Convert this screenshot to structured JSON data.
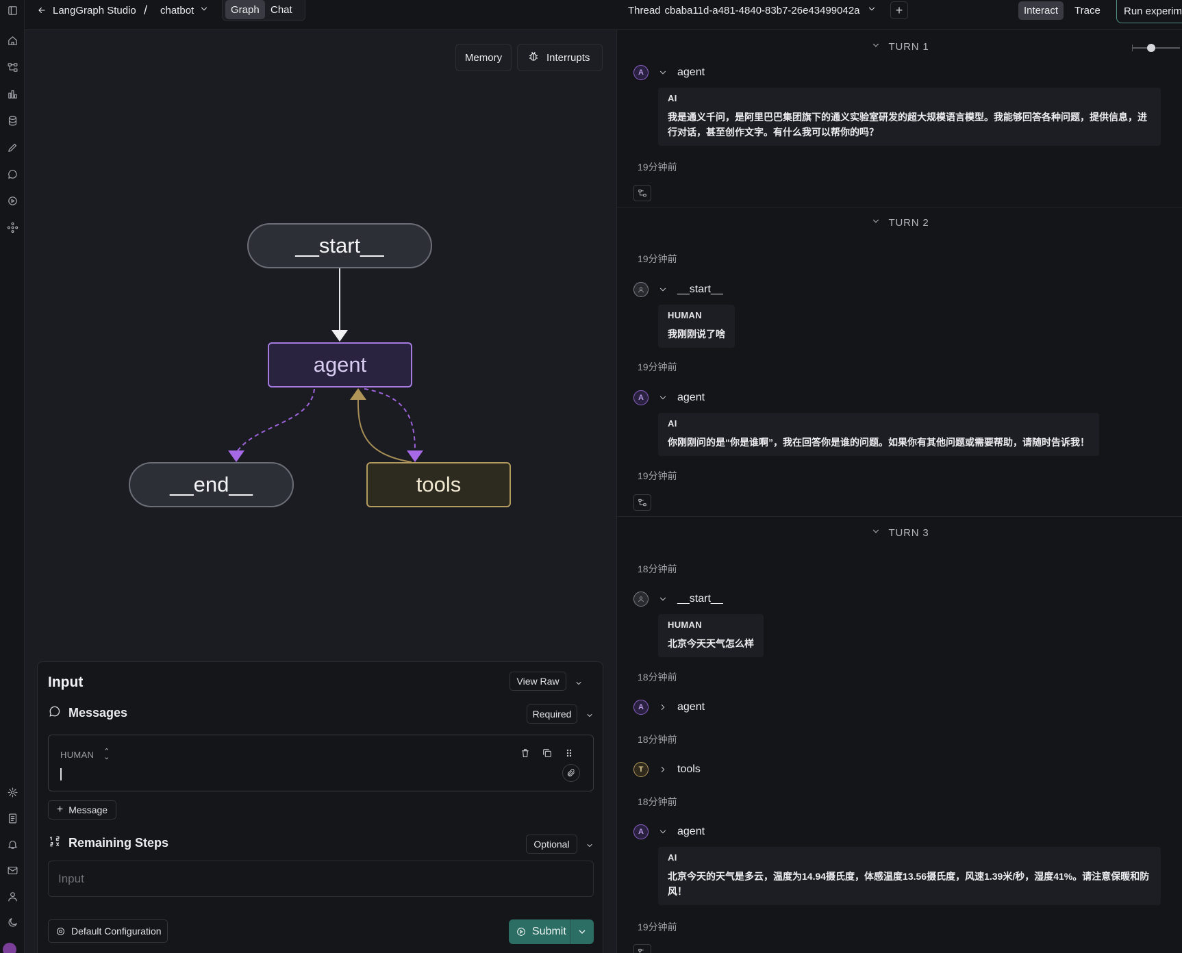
{
  "topbar": {
    "app_name": "LangGraph Studio",
    "separator": "/",
    "graph_name": "chatbot",
    "tab_graph": "Graph",
    "tab_chat": "Chat",
    "thread_label": "Thread",
    "thread_id": "cbaba11d-a481-4840-83b7-26e43499042a",
    "interact": "Interact",
    "trace": "Trace",
    "run_experiment": "Run experim"
  },
  "graph": {
    "memory_button": "Memory",
    "interrupts_button": "Interrupts",
    "nodes": {
      "start": "__start__",
      "agent": "agent",
      "end": "__end__",
      "tools": "tools"
    }
  },
  "input_panel": {
    "title": "Input",
    "view_raw": "View Raw",
    "messages_label": "Messages",
    "messages_required": "Required",
    "message_role": "HUMAN",
    "add_message": "Message",
    "remaining_steps_label": "Remaining Steps",
    "remaining_steps_optional": "Optional",
    "remaining_steps_placeholder": "Input",
    "default_config": "Default Configuration",
    "submit": "Submit"
  },
  "thread": {
    "turns": [
      {
        "label": "TURN 1",
        "agent_node": "agent",
        "ai_role": "AI",
        "ai_text": "我是通义千问，是阿里巴巴集团旗下的通义实验室研发的超大规模语言模型。我能够回答各种问题，提供信息，进行对话，甚至创作文字。有什么我可以帮你的吗？",
        "time": "19分钟前"
      },
      {
        "label": "TURN 2",
        "time_start": "19分钟前",
        "start_node": "__start__",
        "human_role": "HUMAN",
        "human_text": "我刚刚说了啥",
        "time_agent": "19分钟前",
        "agent_node": "agent",
        "ai_role": "AI",
        "ai_text": "你刚刚问的是“你是谁啊”，我在回答你是谁的问题。如果你有其他问题或需要帮助，请随时告诉我！",
        "time_end": "19分钟前"
      },
      {
        "label": "TURN 3",
        "time_start": "18分钟前",
        "start_node": "__start__",
        "human_role": "HUMAN",
        "human_text": "北京今天天气怎么样",
        "time_agent1": "18分钟前",
        "agent_node1": "agent",
        "time_tools": "18分钟前",
        "tools_node": "tools",
        "time_agent2": "18分钟前",
        "agent_node2": "agent",
        "ai_role": "AI",
        "ai_text": "北京今天的天气是多云，温度为14.94摄氏度，体感温度13.56摄氏度，风速1.39米/秒，湿度41%。请注意保暖和防风！",
        "time_end": "19分钟前"
      }
    ],
    "badges": {
      "agent": "A",
      "tools": "T"
    }
  },
  "colors": {
    "agent_accent": "#a57be0",
    "tools_accent": "#b39b5f",
    "submit": "#2c6d64"
  },
  "icons": [
    "panel-toggle-icon",
    "home-icon",
    "graph-icon",
    "chart-icon",
    "database-icon",
    "pen-icon",
    "chat-icon",
    "play-icon",
    "hub-icon",
    "settings-icon",
    "document-icon",
    "bell-icon",
    "mail-icon",
    "user-icon",
    "moon-icon"
  ]
}
